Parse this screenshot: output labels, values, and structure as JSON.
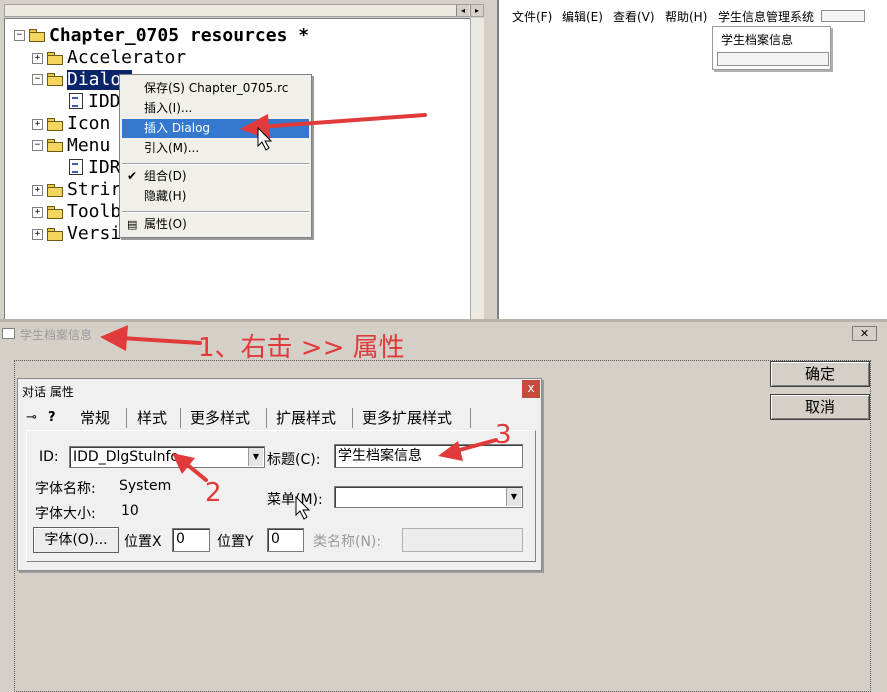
{
  "tree": {
    "root": "Chapter_0705 resources *",
    "accelerator": "Accelerator",
    "dialog": "Dialog",
    "dialog_child": "IDD",
    "icon": "Icon",
    "menu": "Menu",
    "menu_child": "IDR",
    "string": "Strir",
    "toolbar": "Toolb",
    "version": "Versi"
  },
  "context_menu": {
    "save": "保存(S) Chapter_0705.rc",
    "insert": "插入(I)...",
    "insert_dialog": "插入 Dialog",
    "import": "引入(M)...",
    "group": "组合(D)",
    "hide": "隐藏(H)",
    "properties": "属性(O)"
  },
  "menu_preview": {
    "file": "文件(F)",
    "edit": "编辑(E)",
    "view": "查看(V)",
    "help": "帮助(H)",
    "app": "学生信息管理系统",
    "dropdown_item": "学生档案信息"
  },
  "dialog_editor": {
    "title": "学生档案信息",
    "close": "✕",
    "ok": "确定",
    "cancel": "取消"
  },
  "props": {
    "title": "对话 属性",
    "close": "x",
    "pin": "⊸",
    "help": "?",
    "tabs": [
      "常规",
      "样式",
      "更多样式",
      "扩展样式",
      "更多扩展样式"
    ],
    "id_label": "ID:",
    "id_value": "IDD_DlgStuInfo",
    "caption_label": "标题(C):",
    "caption_value": "学生档案信息",
    "font_name_label": "字体名称:",
    "font_name_value": "System",
    "font_size_label": "字体大小:",
    "font_size_value": "10",
    "menu_label": "菜单(M):",
    "menu_value": "",
    "font_button": "字体(O)...",
    "pos_x_label": "位置X",
    "pos_x_value": "0",
    "pos_y_label": "位置Y",
    "pos_y_value": "0",
    "class_label": "类名称(N):",
    "class_value": ""
  },
  "annotations": {
    "step1": "1、右击 >> 属性",
    "step2": "2",
    "step3": "3",
    "color": "#e03a3a"
  }
}
